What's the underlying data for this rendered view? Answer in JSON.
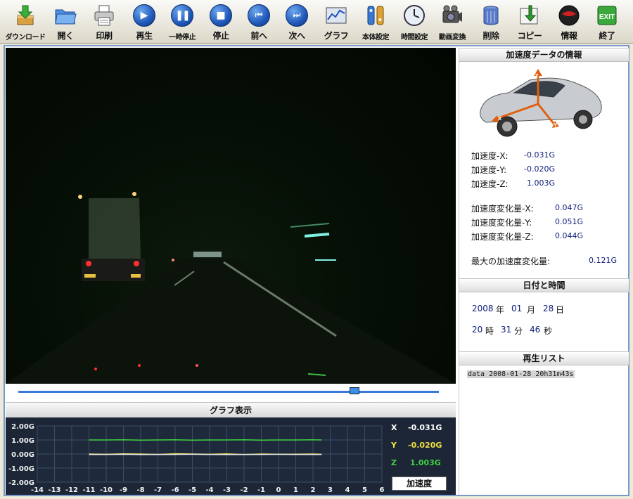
{
  "toolbar": {
    "items": [
      {
        "label": "ダウンロード",
        "icon": "download-icon"
      },
      {
        "label": "開く",
        "icon": "folder-open-icon"
      },
      {
        "label": "印刷",
        "icon": "printer-icon"
      },
      {
        "label": "再生",
        "icon": "play-icon"
      },
      {
        "label": "一時停止",
        "icon": "pause-icon"
      },
      {
        "label": "停止",
        "icon": "stop-icon"
      },
      {
        "label": "前へ",
        "icon": "previous-icon"
      },
      {
        "label": "次へ",
        "icon": "next-icon"
      },
      {
        "label": "グラフ",
        "icon": "graph-icon"
      },
      {
        "label": "本体設定",
        "icon": "device-settings-icon"
      },
      {
        "label": "時間設定",
        "icon": "clock-icon"
      },
      {
        "label": "動画変換",
        "icon": "video-convert-icon"
      },
      {
        "label": "削除",
        "icon": "delete-icon"
      },
      {
        "label": "コピー",
        "icon": "copy-icon"
      },
      {
        "label": "情報",
        "icon": "info-icon"
      },
      {
        "label": "終了",
        "icon": "exit-icon",
        "badge": "EXIT"
      }
    ]
  },
  "playback": {
    "position": 0.8
  },
  "graph": {
    "title": "グラフ表示",
    "button_label": "加速度",
    "readouts": {
      "x_label": "X",
      "x_value": "-0.031G",
      "y_label": "Y",
      "y_value": "-0.020G",
      "z_label": "Z",
      "z_value": "1.003G"
    }
  },
  "info": {
    "accel_title": "加速度データの情報",
    "accel_x_label": "加速度-X:",
    "accel_x": "-0.031G",
    "accel_y_label": "加速度-Y:",
    "accel_y": "-0.020G",
    "accel_z_label": "加速度-Z:",
    "accel_z": "1.003G",
    "delta_x_label": "加速度変化量-X:",
    "delta_x": "0.047G",
    "delta_y_label": "加速度変化量-Y:",
    "delta_y": "0.051G",
    "delta_z_label": "加速度変化量-Z:",
    "delta_z": "0.044G",
    "max_delta_label": "最大の加速度変化量:",
    "max_delta": "0.121G",
    "car_axis_z": "Z",
    "car_axis_x": "X",
    "car_axis_y": "Y"
  },
  "datetime": {
    "title": "日付と時間",
    "year": "2008",
    "year_unit": "年",
    "month": "01",
    "month_unit": "月",
    "day": "28",
    "day_unit": "日",
    "hour": "20",
    "hour_unit": "時",
    "minute": "31",
    "minute_unit": "分",
    "second": "46",
    "second_unit": "秒"
  },
  "playlist": {
    "title": "再生リスト",
    "items": [
      "data 2008-01-28 20h31m43s"
    ]
  },
  "chart_data": {
    "type": "line",
    "title": "",
    "xlabel": "",
    "ylabel": "",
    "xlim": [
      -14,
      6
    ],
    "ylim": [
      -2,
      2
    ],
    "x_ticks": [
      "-14",
      "-13",
      "-12",
      "-11",
      "-10",
      "-9",
      "-8",
      "-7",
      "-6",
      "-5",
      "-4",
      "-3",
      "-2",
      "-1",
      "0",
      "1",
      "2",
      "3",
      "4",
      "5",
      "6"
    ],
    "y_ticks": [
      "2.00G",
      "1.00G",
      "0.00G",
      "-1.00G",
      "-2.00G"
    ],
    "grid": true,
    "x": [
      -11,
      -10,
      -9,
      -8,
      -7,
      -6,
      -5,
      -4,
      -3,
      -2,
      -1,
      0,
      1,
      2,
      2.5
    ],
    "series": [
      {
        "color": "#3fd23f",
        "values": [
          1.0,
          1.0,
          1.01,
          0.99,
          1.0,
          1.01,
          0.99,
          1.0,
          1.0,
          1.01,
          0.99,
          1.0,
          1.0,
          1.01,
          1.0
        ]
      },
      {
        "color": "#f0e040",
        "values": [
          0.0,
          -0.02,
          0.01,
          0.0,
          -0.03,
          0.02,
          0.0,
          -0.02,
          0.01,
          -0.04,
          0.0,
          -0.02,
          -0.01,
          0.0,
          -0.02
        ]
      },
      {
        "color": "#e8e8e8",
        "values": [
          -0.03,
          -0.03,
          -0.02,
          -0.04,
          -0.03,
          -0.03,
          -0.02,
          -0.03,
          -0.04,
          -0.03,
          -0.03,
          -0.02,
          -0.03,
          -0.03,
          -0.03
        ]
      }
    ]
  }
}
